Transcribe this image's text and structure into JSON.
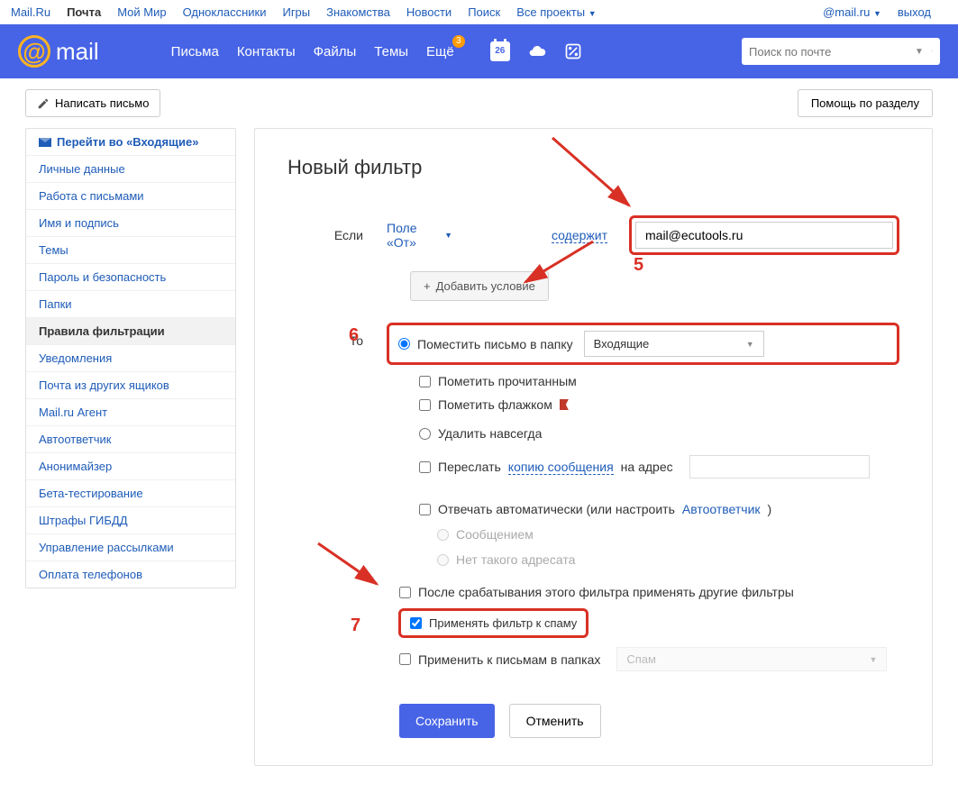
{
  "topbar": {
    "items": [
      "Mail.Ru",
      "Почта",
      "Мой Мир",
      "Одноклассники",
      "Игры",
      "Знакомства",
      "Новости",
      "Поиск"
    ],
    "projects": "Все проекты",
    "email": "@mail.ru",
    "exit": "выход"
  },
  "header": {
    "logo": "mail",
    "nav": [
      "Письма",
      "Контакты",
      "Файлы",
      "Темы",
      "Ещё"
    ],
    "badge": "3",
    "cal_day": "26",
    "search_placeholder": "Поиск по почте"
  },
  "subhead": {
    "compose": "Написать письмо",
    "help": "Помощь по разделу"
  },
  "sidebar": {
    "inbox": "Перейти во «Входящие»",
    "items": [
      "Личные данные",
      "Работа с письмами",
      "Имя и подпись",
      "Темы",
      "Пароль и безопасность",
      "Папки",
      "Правила фильтрации",
      "Уведомления",
      "Почта из других ящиков",
      "Mail.ru Агент",
      "Автоответчик",
      "Анонимайзер",
      "Бета-тестирование",
      "Штрафы ГИБДД",
      "Управление рассылками",
      "Оплата телефонов"
    ],
    "active_index": 6
  },
  "content": {
    "title": "Новый фильтр",
    "if_label": "Если",
    "field": "Поле «От»",
    "contains": "содержит",
    "value": "mail@ecutools.ru",
    "add_cond": "Добавить условие",
    "to_label": "То",
    "move_to": "Поместить письмо в папку",
    "folder": "Входящие",
    "mark_read": "Пометить прочитанным",
    "flag": "Пометить флажком",
    "delete": "Удалить навсегда",
    "forward": "Переслать",
    "forward_link": "копию сообщения",
    "forward_to": "на адрес",
    "autoreply": "Отвечать автоматически (или настроить",
    "autoreply_link": "Автоответчик",
    "reply_msg": "Сообщением",
    "reply_no": "Нет такого адресата",
    "after": "После срабатывания этого фильтра применять другие фильтры",
    "spam": "Применять фильтр к спаму",
    "folders_apply": "Применить к письмам в папках",
    "folders_ph": "Спам",
    "save": "Сохранить",
    "cancel": "Отменить"
  },
  "anno": {
    "n5": "5",
    "n6": "6",
    "n7": "7"
  }
}
